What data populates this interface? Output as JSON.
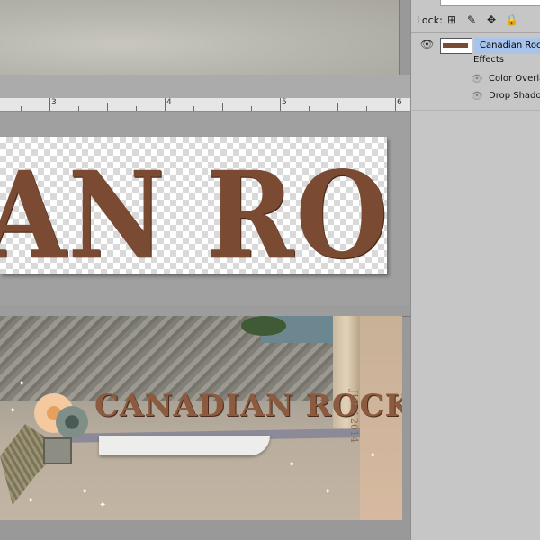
{
  "ruler": {
    "labels": [
      "3",
      "4",
      "5",
      "6"
    ]
  },
  "canvas": {
    "title_art": "AN ROCKIES"
  },
  "preview": {
    "title": "CANADIAN ROCKIES",
    "date": "JULY 2014"
  },
  "layers": {
    "lock_label": "Lock:",
    "lock_icons": [
      "transparency-lock-icon",
      "brush-lock-icon",
      "move-lock-icon",
      "padlock-icon"
    ],
    "layer": {
      "name": "Canadian Rockies"
    },
    "effects_label": "Effects",
    "effects": [
      "Color Overlay",
      "Drop Shadow"
    ]
  },
  "colors": {
    "selection": "#a9c4ea",
    "panel": "#c6c6c6",
    "title_brown": "#7a4a33"
  }
}
